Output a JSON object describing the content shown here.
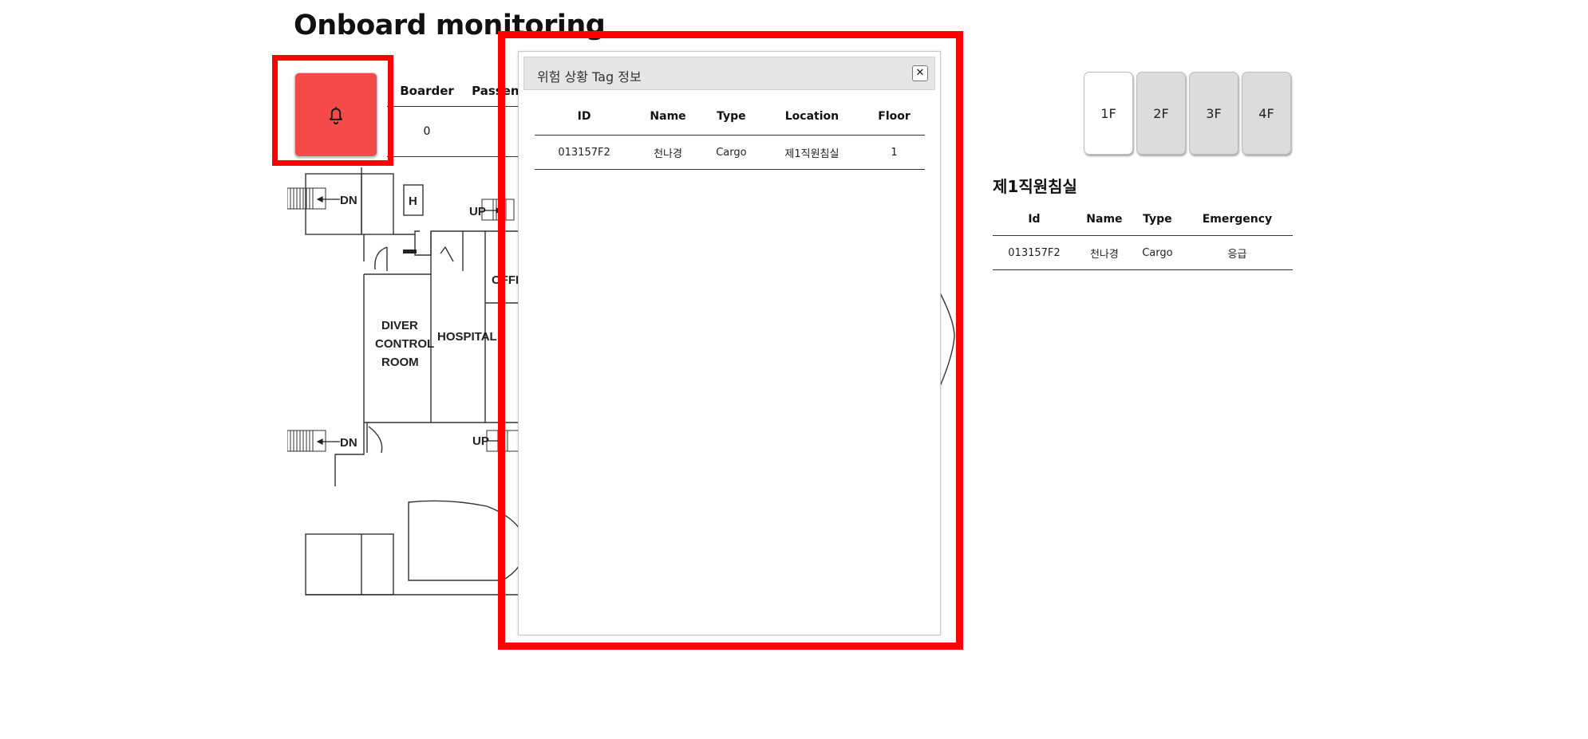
{
  "page": {
    "title": "Onboard monitoring"
  },
  "alarm": {
    "icon": "bell-icon"
  },
  "counts": {
    "headers": [
      "Boarder",
      "Passenger"
    ],
    "values": [
      "0",
      ""
    ]
  },
  "floorplan": {
    "labels": {
      "diver": [
        "DIVER",
        "CONTROL",
        "ROOM"
      ],
      "hospital": "HOSPITAL",
      "office": "OFFICE",
      "h": "H",
      "up1": "UP",
      "up2": "UP",
      "dn1": "DN",
      "dn2": "DN"
    }
  },
  "modal": {
    "title": "위험 상황 Tag 정보",
    "close_icon": "close-icon",
    "headers": [
      "ID",
      "Name",
      "Type",
      "Location",
      "Floor"
    ],
    "rows": [
      [
        "013157F2",
        "천나경",
        "Cargo",
        "제1직원침실",
        "1"
      ]
    ]
  },
  "floors": [
    "1F",
    "2F",
    "3F",
    "4F"
  ],
  "selected_floor": "1F",
  "location_panel": {
    "title": "제1직원침실",
    "headers": [
      "Id",
      "Name",
      "Type",
      "Emergency"
    ],
    "rows": [
      [
        "013157F2",
        "천나경",
        "Cargo",
        "응급"
      ]
    ]
  },
  "colors": {
    "alarm": "#f44a4a",
    "highlight": "#ff0000",
    "emergency": "#ff2020"
  }
}
